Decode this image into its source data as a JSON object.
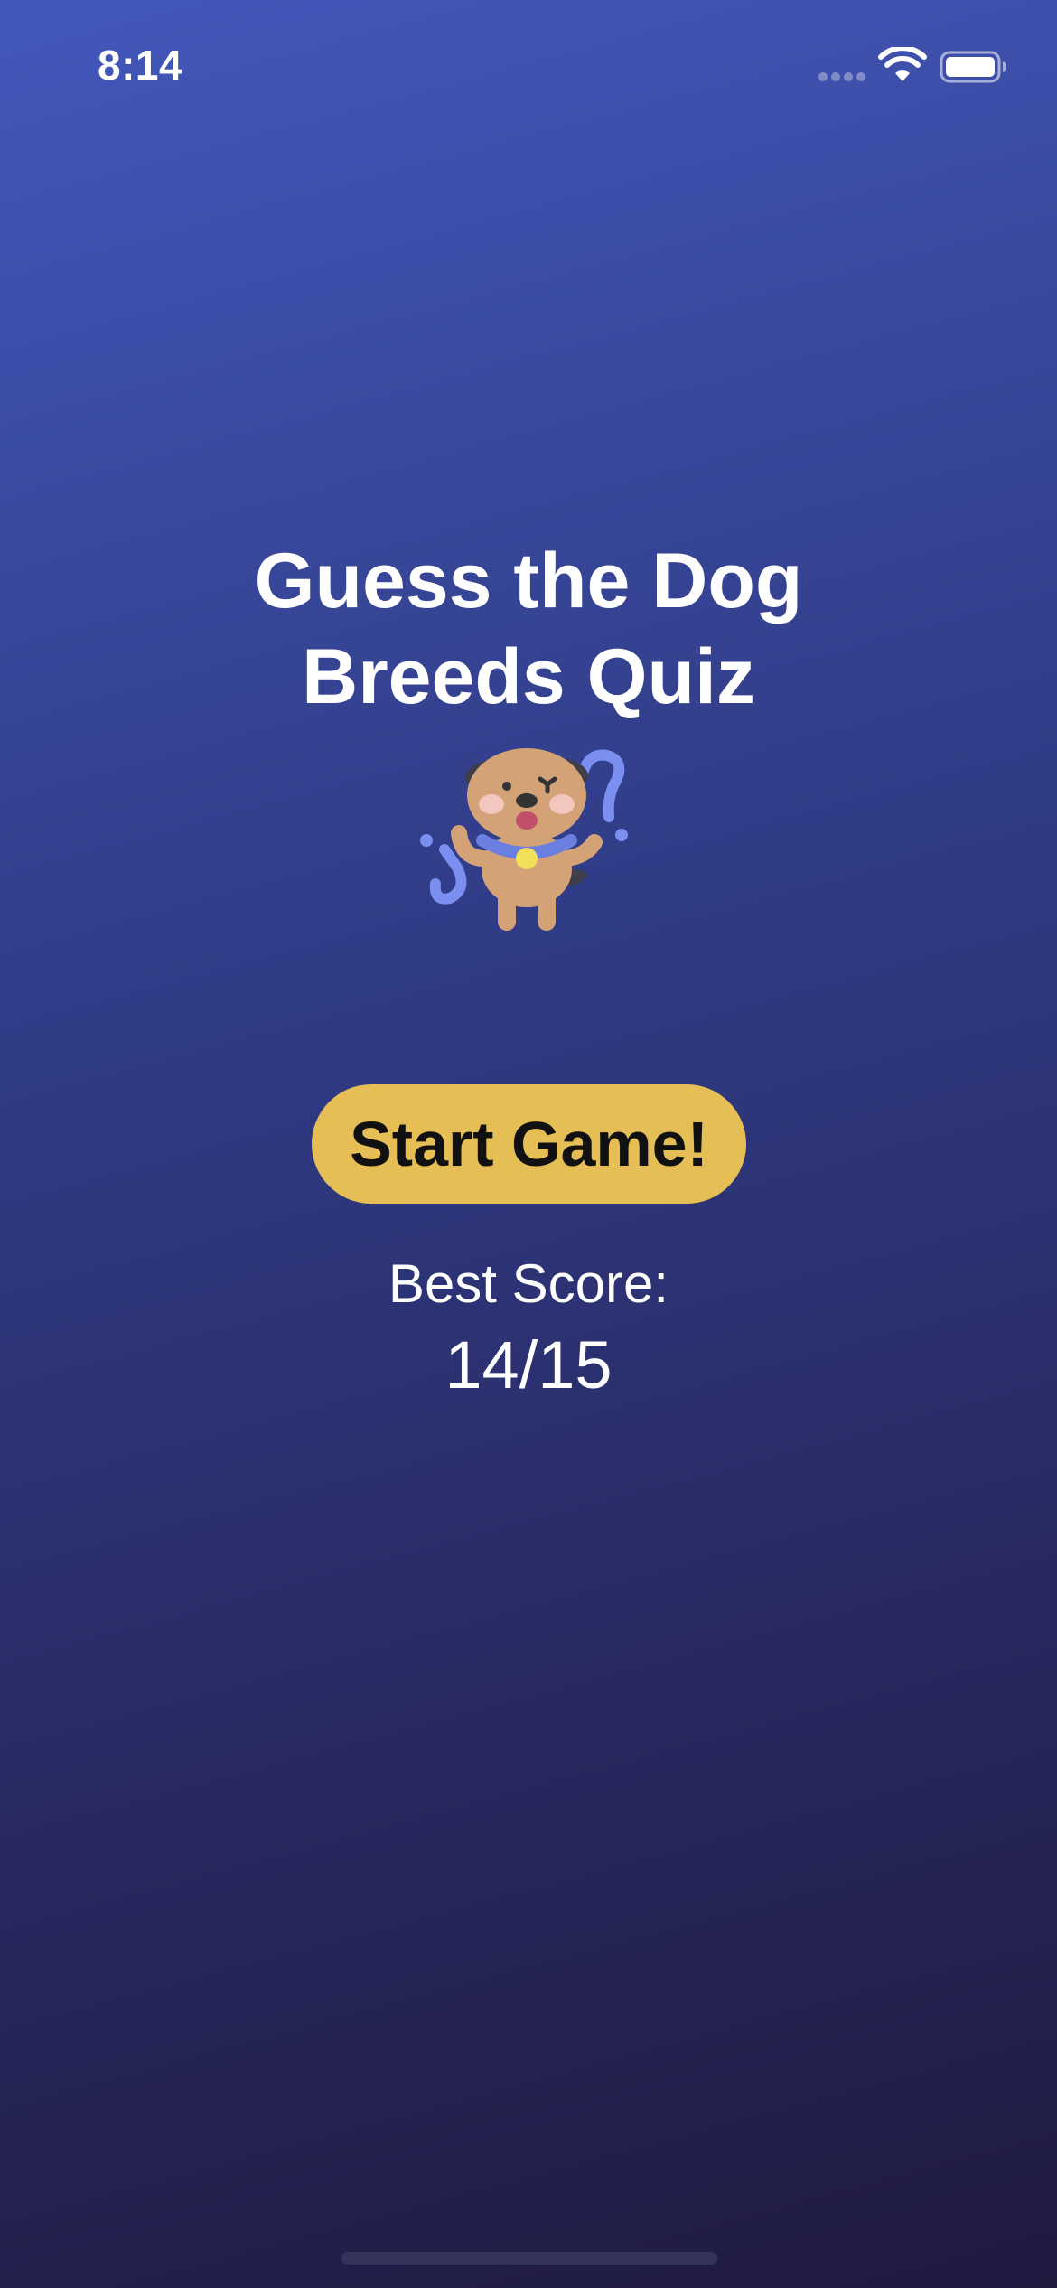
{
  "status_bar": {
    "time": "8:14",
    "wifi_icon": "wifi-icon",
    "battery_icon": "battery-full-icon"
  },
  "main": {
    "title": "Guess the Dog\nBreeds Quiz",
    "mascot": "confused-dog-icon",
    "start_button_label": "Start Game!",
    "best_score_label": "Best Score:",
    "best_score_value": "14/15"
  },
  "colors": {
    "background_top": "#4358bd",
    "background_bottom": "#1f1a40",
    "button": "#e5bf55",
    "button_text": "#111111",
    "text": "#ffffff"
  }
}
